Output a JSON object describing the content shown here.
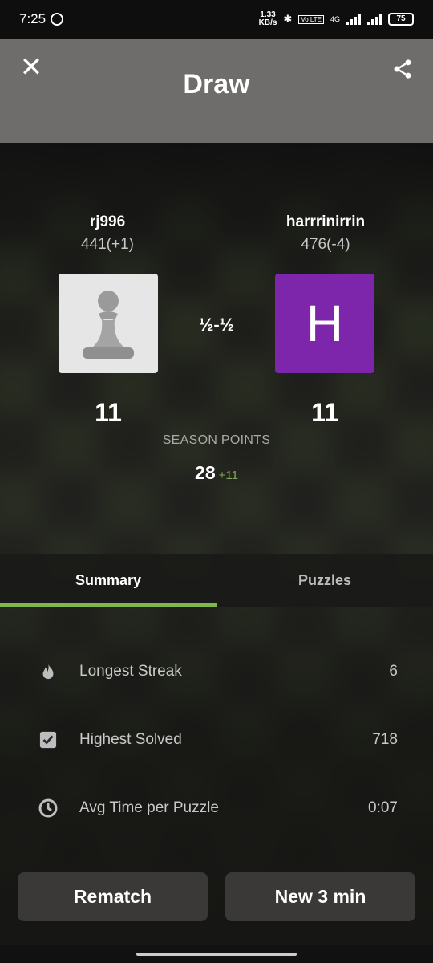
{
  "status_bar": {
    "time": "7:25",
    "net_speed_top": "1.33",
    "net_speed_unit": "KB/s",
    "network": "4G",
    "volte": "Vo LTE",
    "battery": "75"
  },
  "header": {
    "title": "Draw",
    "close_icon": "close-icon",
    "share_icon": "share-icon"
  },
  "players": {
    "left": {
      "name": "rj996",
      "rating": "441(+1)",
      "score": "11",
      "avatar_icon": "pawn-icon"
    },
    "right": {
      "name": "harrrinirrin",
      "rating": "476(-4)",
      "score": "11",
      "avatar_letter": "H",
      "avatar_color": "#7d26ac"
    }
  },
  "result": "½-½",
  "season": {
    "label": "SEASON POINTS",
    "points": "28",
    "delta": "+11",
    "delta_color": "#7fa650"
  },
  "tabs": [
    {
      "label": "Summary",
      "active": true
    },
    {
      "label": "Puzzles",
      "active": false
    }
  ],
  "accent_color": "#81b64c",
  "stats": [
    {
      "icon": "flame-icon",
      "label": "Longest Streak",
      "value": "6"
    },
    {
      "icon": "checkbox-icon",
      "label": "Highest Solved",
      "value": "718"
    },
    {
      "icon": "clock-icon",
      "label": "Avg Time per Puzzle",
      "value": "0:07"
    }
  ],
  "buttons": {
    "rematch": "Rematch",
    "new_game": "New 3 min"
  }
}
